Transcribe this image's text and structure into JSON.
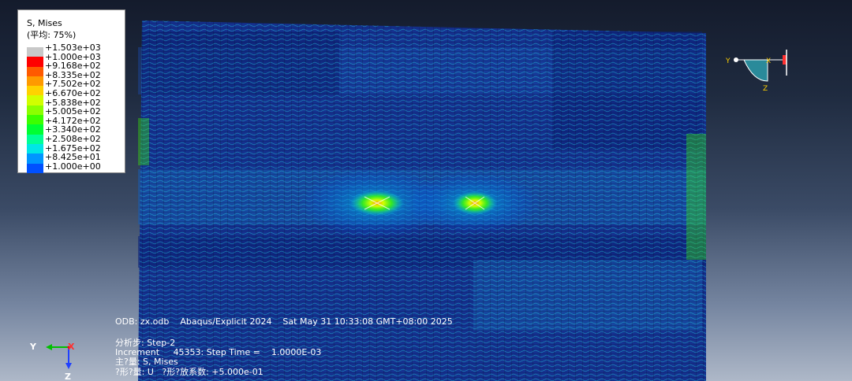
{
  "legend": {
    "title": "S, Mises",
    "subtitle": "(平均: 75%)",
    "values": [
      "+1.503e+03",
      "+1.000e+03",
      "+9.168e+02",
      "+8.335e+02",
      "+7.502e+02",
      "+6.670e+02",
      "+5.838e+02",
      "+5.005e+02",
      "+4.172e+02",
      "+3.340e+02",
      "+2.508e+02",
      "+1.675e+02",
      "+8.425e+01",
      "+1.000e+00"
    ],
    "colors": [
      "#c8c8c8",
      "#ff0000",
      "#ff5a00",
      "#ff9a00",
      "#ffd200",
      "#d2ff00",
      "#8cff00",
      "#3cff00",
      "#00ff32",
      "#00ff96",
      "#00e6e6",
      "#0096ff",
      "#0050ff",
      "#0000ff"
    ]
  },
  "info": {
    "odb_line": "ODB: zx.odb    Abaqus/Explicit 2024    Sat May 31 10:33:08 GMT+08:00 2025",
    "step_line": "分析步: Step-2",
    "increment_line": "Increment     45353: Step Time =    1.0000E-03",
    "primary_var_line": "主?量: S, Mises",
    "deformed_var_line": "?形?量: U   ?形?放系数: +5.000e-01"
  },
  "triad_main": {
    "y_label": "Y",
    "x_label": "X",
    "z_label": "Z"
  },
  "triad_mini": {
    "y_label": "Y",
    "x_label": "X",
    "z_label": "Z"
  },
  "colors": {
    "mesh_dark": "#0d1a6b",
    "mesh_mid": "#1c3ea8",
    "hot_spot": "#d2ff00",
    "text": "#ffffff"
  }
}
